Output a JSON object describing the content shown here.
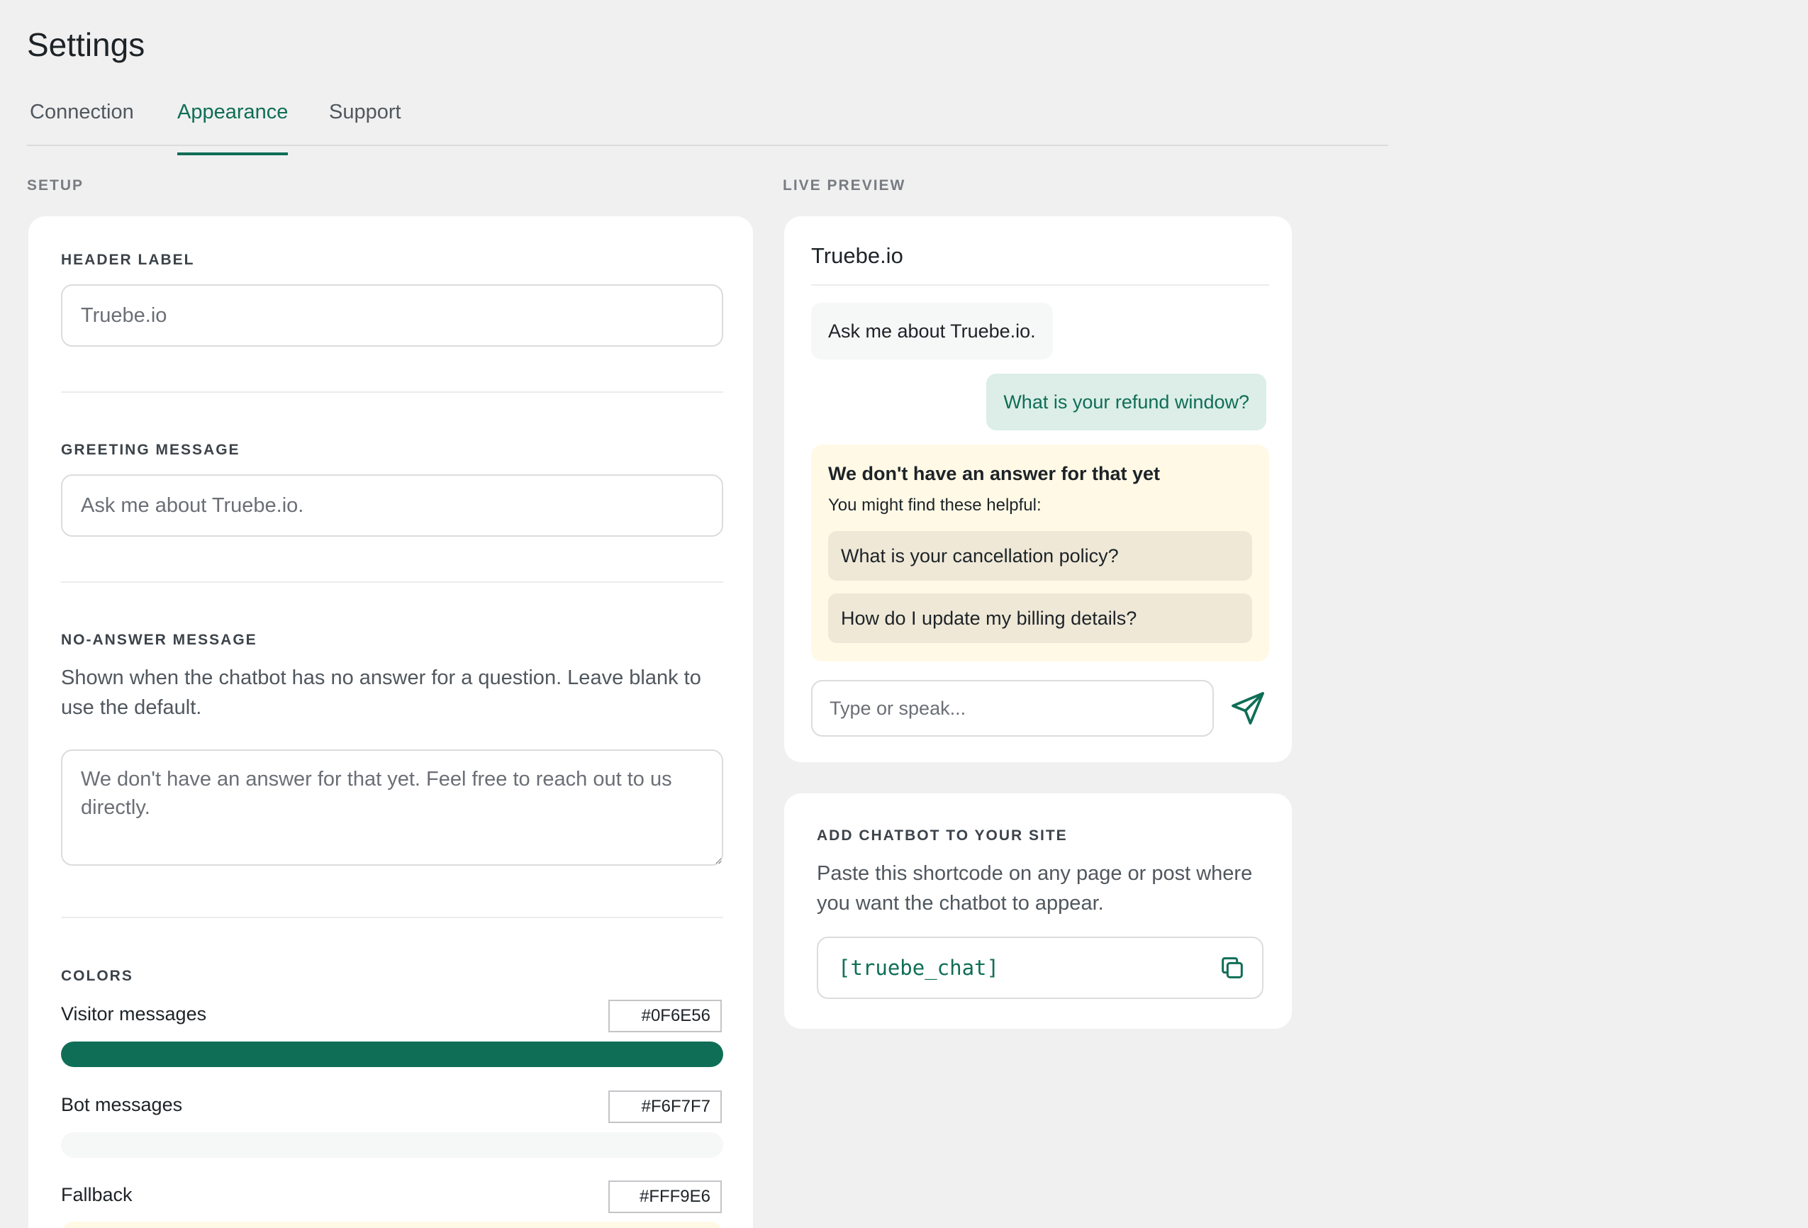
{
  "page": {
    "title": "Settings"
  },
  "tabs": [
    {
      "label": "Connection",
      "active": false
    },
    {
      "label": "Appearance",
      "active": true
    },
    {
      "label": "Support",
      "active": false
    }
  ],
  "setup": {
    "section_label": "SETUP",
    "header_label": {
      "label": "HEADER LABEL",
      "placeholder": "Truebe.io"
    },
    "greeting": {
      "label": "GREETING MESSAGE",
      "placeholder": "Ask me about Truebe.io."
    },
    "no_answer": {
      "label": "NO-ANSWER MESSAGE",
      "help": "Shown when the chatbot has no answer for a question. Leave blank to use the default.",
      "placeholder": "We don't have an answer for that yet. Feel free to reach out to us directly."
    },
    "colors": {
      "label": "COLORS",
      "items": [
        {
          "label": "Visitor messages",
          "hex": "#0F6E56"
        },
        {
          "label": "Bot messages",
          "hex": "#F6F7F7"
        },
        {
          "label": "Fallback",
          "hex": "#FFF9E6"
        }
      ]
    }
  },
  "preview": {
    "section_label": "LIVE PREVIEW",
    "title": "Truebe.io",
    "bot_message": "Ask me about Truebe.io.",
    "visitor_message": "What is your refund window?",
    "fallback": {
      "title": "We don't have an answer for that yet",
      "subtitle": "You might find these helpful:",
      "suggestions": [
        "What is your cancellation policy?",
        "How do I update my billing details?"
      ]
    },
    "input_placeholder": "Type or speak..."
  },
  "embed": {
    "label": "ADD CHATBOT TO YOUR SITE",
    "help": "Paste this shortcode on any page or post where you want the chatbot to appear.",
    "shortcode": "[truebe_chat]"
  }
}
